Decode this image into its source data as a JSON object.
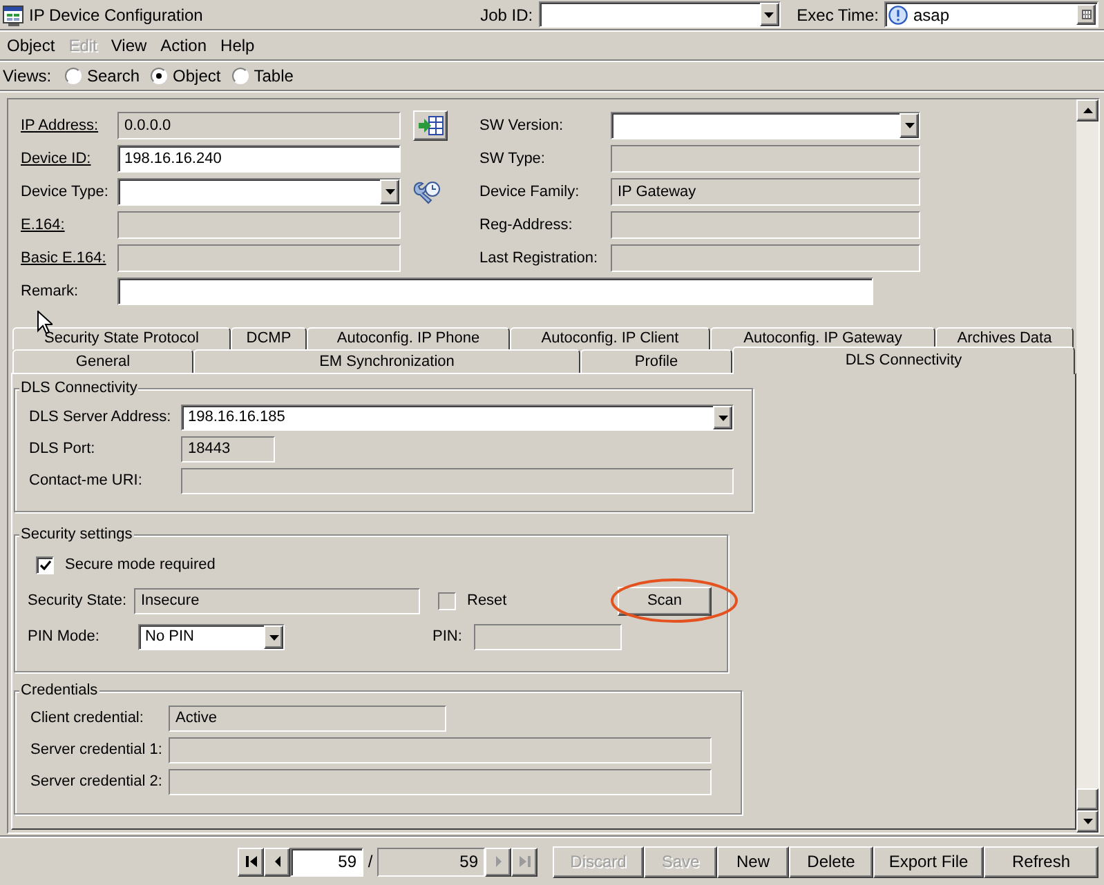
{
  "window": {
    "title": "IP Device Configuration"
  },
  "header": {
    "job_id": {
      "label": "Job ID:"
    },
    "exec_time": {
      "label": "Exec Time:",
      "value": "asap"
    }
  },
  "menu": [
    {
      "label": "Object",
      "disabled": false
    },
    {
      "label": "Edit",
      "disabled": true
    },
    {
      "label": "View",
      "disabled": false
    },
    {
      "label": "Action",
      "disabled": false
    },
    {
      "label": "Help",
      "disabled": false
    }
  ],
  "views": {
    "label": "Views:",
    "options": [
      {
        "label": "Search",
        "selected": false
      },
      {
        "label": "Object",
        "selected": true
      },
      {
        "label": "Table",
        "selected": false
      }
    ]
  },
  "device_form": {
    "left_fields": [
      {
        "label": "IP Address:",
        "underlined": true,
        "kind": "text",
        "readonly": true,
        "value": "0.0.0.0"
      },
      {
        "label": "Device ID:",
        "underlined": true,
        "kind": "text",
        "readonly": false,
        "value": "198.16.16.240"
      },
      {
        "label": "Device Type:",
        "underlined": false,
        "kind": "combo",
        "readonly": false
      },
      {
        "label": "E.164:",
        "underlined": true,
        "kind": "text",
        "readonly": true
      },
      {
        "label": "Basic E.164:",
        "underlined": true,
        "kind": "text",
        "readonly": true
      }
    ],
    "right_fields": [
      {
        "label": "SW Version:",
        "underlined": false,
        "kind": "combo",
        "readonly": false
      },
      {
        "label": "SW Type:",
        "underlined": false,
        "kind": "text",
        "readonly": true
      },
      {
        "label": "Device Family:",
        "underlined": false,
        "kind": "text",
        "readonly": true,
        "value": "IP Gateway"
      },
      {
        "label": "Reg-Address:",
        "underlined": false,
        "kind": "text",
        "readonly": true
      },
      {
        "label": "Last Registration:",
        "underlined": false,
        "kind": "text",
        "readonly": true
      }
    ],
    "remark": {
      "label": "Remark:",
      "underlined": false,
      "kind": "text",
      "readonly": false
    }
  },
  "tabs": {
    "back_row": [
      {
        "label": "Security State Protocol",
        "selected": false
      },
      {
        "label": "DCMP",
        "selected": false
      },
      {
        "label": "Autoconfig. IP Phone",
        "selected": false
      },
      {
        "label": "Autoconfig. IP Client",
        "selected": false
      },
      {
        "label": "Autoconfig. IP Gateway",
        "selected": false
      },
      {
        "label": "Archives Data",
        "selected": false
      }
    ],
    "front_row": [
      {
        "label": "General",
        "selected": false
      },
      {
        "label": "EM Synchronization",
        "selected": false
      },
      {
        "label": "Profile",
        "selected": false
      },
      {
        "label": "DLS Connectivity",
        "selected": true
      }
    ]
  },
  "dls_connectivity": {
    "title": "DLS Connectivity",
    "fields": [
      {
        "label": "DLS Server Address:",
        "kind": "combo",
        "readonly": false,
        "value": "198.16.16.185"
      },
      {
        "label": "DLS Port:",
        "kind": "text",
        "readonly": true,
        "value": "18443"
      },
      {
        "label": "Contact-me URI:",
        "kind": "text",
        "readonly": true
      }
    ]
  },
  "security_settings": {
    "title": "Security settings",
    "secure_mode": {
      "label": "Secure mode required",
      "checked": true,
      "disabled": false
    },
    "security_state": {
      "label": "Security State:",
      "kind": "text",
      "readonly": true,
      "value": "Insecure"
    },
    "reset": {
      "label": "Reset",
      "checked": false,
      "disabled": true
    },
    "scan_button": {
      "label": "Scan",
      "highlighted": true
    },
    "pin_mode": {
      "label": "PIN Mode:",
      "kind": "combo",
      "readonly": false,
      "value": "No PIN"
    },
    "pin": {
      "label": "PIN:",
      "kind": "text",
      "readonly": true
    }
  },
  "credentials": {
    "title": "Credentials",
    "fields": [
      {
        "label": "Client credential:",
        "kind": "text",
        "readonly": true,
        "value": "Active"
      },
      {
        "label": "Server credential 1:",
        "kind": "text",
        "readonly": true
      },
      {
        "label": "Server credential 2:",
        "kind": "text",
        "readonly": true
      }
    ]
  },
  "navigator": {
    "buttons_before": [
      {
        "kind": "first",
        "disabled": false
      },
      {
        "kind": "prev",
        "disabled": false
      }
    ],
    "page": "59",
    "separator": "/",
    "total": "59",
    "buttons_after": [
      {
        "kind": "next",
        "disabled": true
      },
      {
        "kind": "last",
        "disabled": true
      }
    ]
  },
  "buttons": [
    {
      "label": "Discard",
      "disabled": true
    },
    {
      "label": "Save",
      "disabled": true
    },
    {
      "label": "New",
      "disabled": false
    },
    {
      "label": "Delete",
      "disabled": false
    },
    {
      "label": "Export File",
      "disabled": false
    },
    {
      "label": "Refresh",
      "disabled": false
    }
  ]
}
